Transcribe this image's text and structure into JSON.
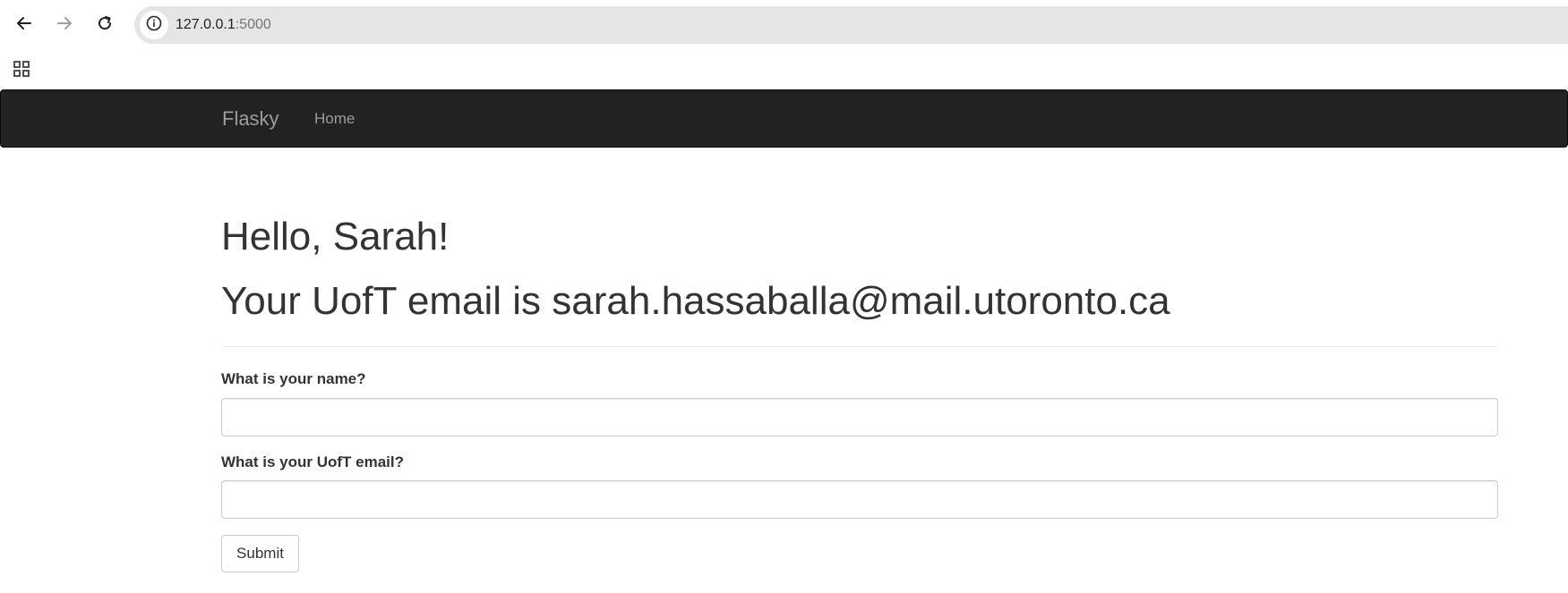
{
  "browser": {
    "address_host": "127.0.0.1",
    "address_port": ":5000",
    "icons": [
      "back-icon",
      "forward-icon",
      "reload-icon",
      "site-info-icon",
      "apps-icon"
    ]
  },
  "navbar": {
    "brand": "Flasky",
    "links": [
      {
        "label": "Home"
      }
    ],
    "background_color": "#222222",
    "text_color": "#9d9d9d"
  },
  "main": {
    "greeting": "Hello, Sarah!",
    "email_message": "Your UofT email is sarah.hassaballa@mail.utoronto.ca",
    "form": {
      "name_label": "What is your name?",
      "name_value": "",
      "email_label": "What is your UofT email?",
      "email_value": "",
      "submit_label": "Submit"
    }
  }
}
